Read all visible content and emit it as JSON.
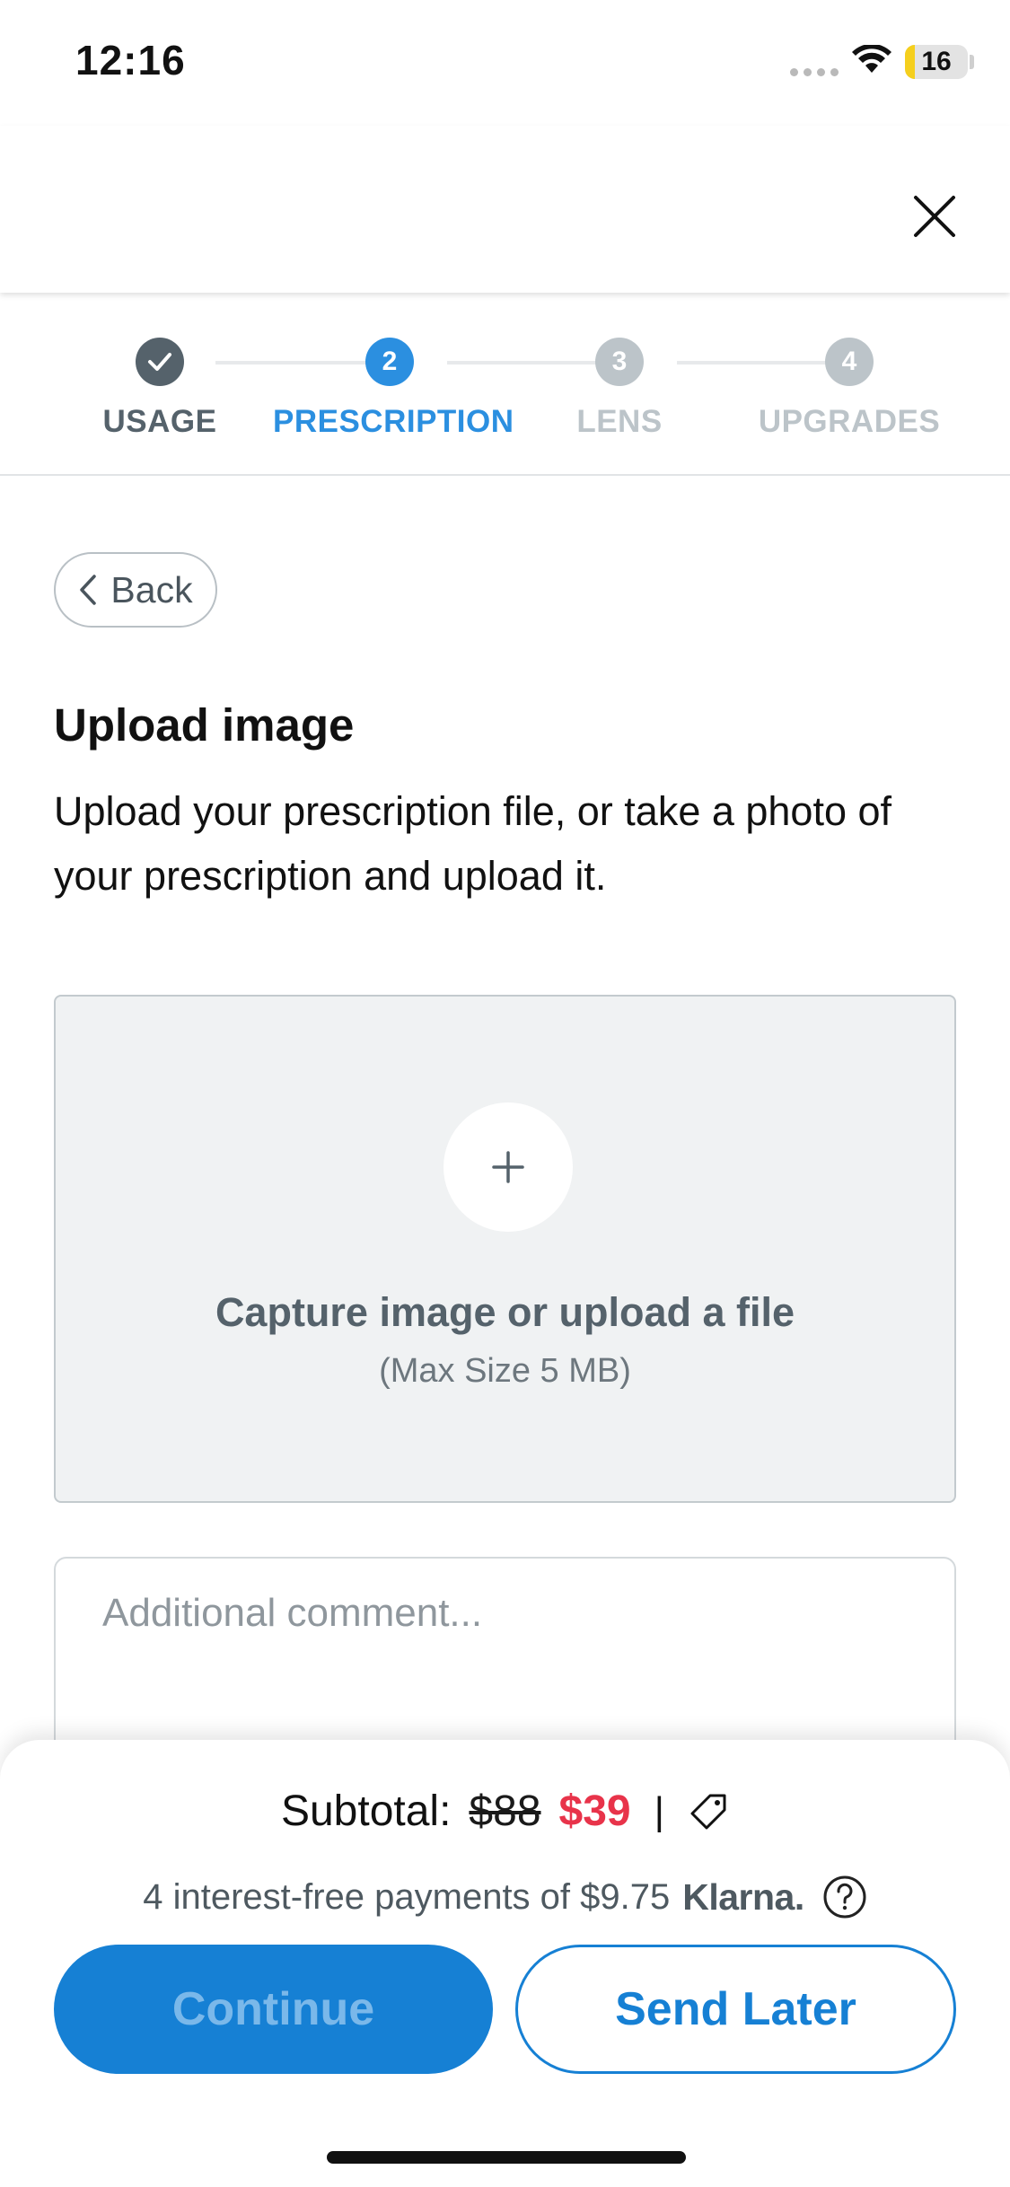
{
  "status_bar": {
    "time": "12:16",
    "battery_level": "16",
    "battery_fraction": 0.16,
    "battery_color": "#f5cf1d"
  },
  "header": {
    "close_icon": "close-icon"
  },
  "stepper": {
    "active_color": "#2b8fe0",
    "done_color": "#55626b",
    "pending_color": "#bcc4c9",
    "steps": [
      {
        "number": "",
        "label": "USAGE",
        "state": "done"
      },
      {
        "number": "2",
        "label": "PRESCRIPTION",
        "state": "active"
      },
      {
        "number": "3",
        "label": "LENS",
        "state": "pending"
      },
      {
        "number": "4",
        "label": "UPGRADES",
        "state": "pending"
      }
    ]
  },
  "back_button": {
    "label": "Back",
    "icon": "chevron-left-icon"
  },
  "content": {
    "title": "Upload image",
    "description": "Upload your prescription file, or take a photo of your prescription and upload it."
  },
  "upload": {
    "icon": "plus-icon",
    "title": "Capture image or upload a file",
    "subtitle": "(Max Size 5 MB)"
  },
  "comment": {
    "placeholder": "Additional comment...",
    "value": ""
  },
  "summary": {
    "subtotal_label": "Subtotal:",
    "old_price": "$88",
    "new_price": "$39",
    "divider": "|",
    "price_color": "#e8334a",
    "tag_icon": "tag-icon",
    "klarna_text": "4 interest-free payments of $9.75",
    "klarna_logo": "Klarna.",
    "help_icon": "question-circle-icon"
  },
  "actions": {
    "continue_label": "Continue",
    "send_later_label": "Send Later",
    "accent_color": "#1680d4"
  }
}
